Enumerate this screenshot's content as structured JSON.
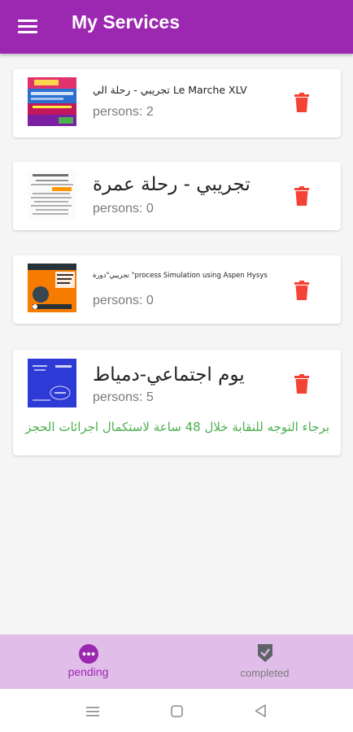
{
  "header": {
    "title": "My Services",
    "menu_icon": "hamburger-menu-icon"
  },
  "services": [
    {
      "name": "تجريبي - رحلة الي Le Marche XLV",
      "persons": "persons: 2",
      "thumb_icon": "event-poster-thumbnail"
    },
    {
      "name": "تجريبي - رحلة عمرة",
      "persons": "persons: 0",
      "thumb_icon": "document-thumbnail"
    },
    {
      "name": "تجريبي\"دورة \"process Simulation using Aspen Hysys",
      "persons": "persons: 0",
      "thumb_icon": "course-poster-thumbnail"
    },
    {
      "name": "يوم اجتماعي-دمياط",
      "persons": "persons: 5",
      "thumb_icon": "blue-poster-thumbnail",
      "note": "برجاء التوجه للنقابة خلال 48 ساعة لاستكمال اجرائات الحجز"
    }
  ],
  "bottom_nav": {
    "pending": {
      "label": "pending",
      "icon": "more-dots-icon"
    },
    "completed": {
      "label": "completed",
      "icon": "shield-check-icon"
    }
  },
  "colors": {
    "primary": "#9c27b0",
    "nav_background": "#e1bde9",
    "delete": "#f44336",
    "note": "#4caf50",
    "inactive": "#7a7a7a"
  }
}
